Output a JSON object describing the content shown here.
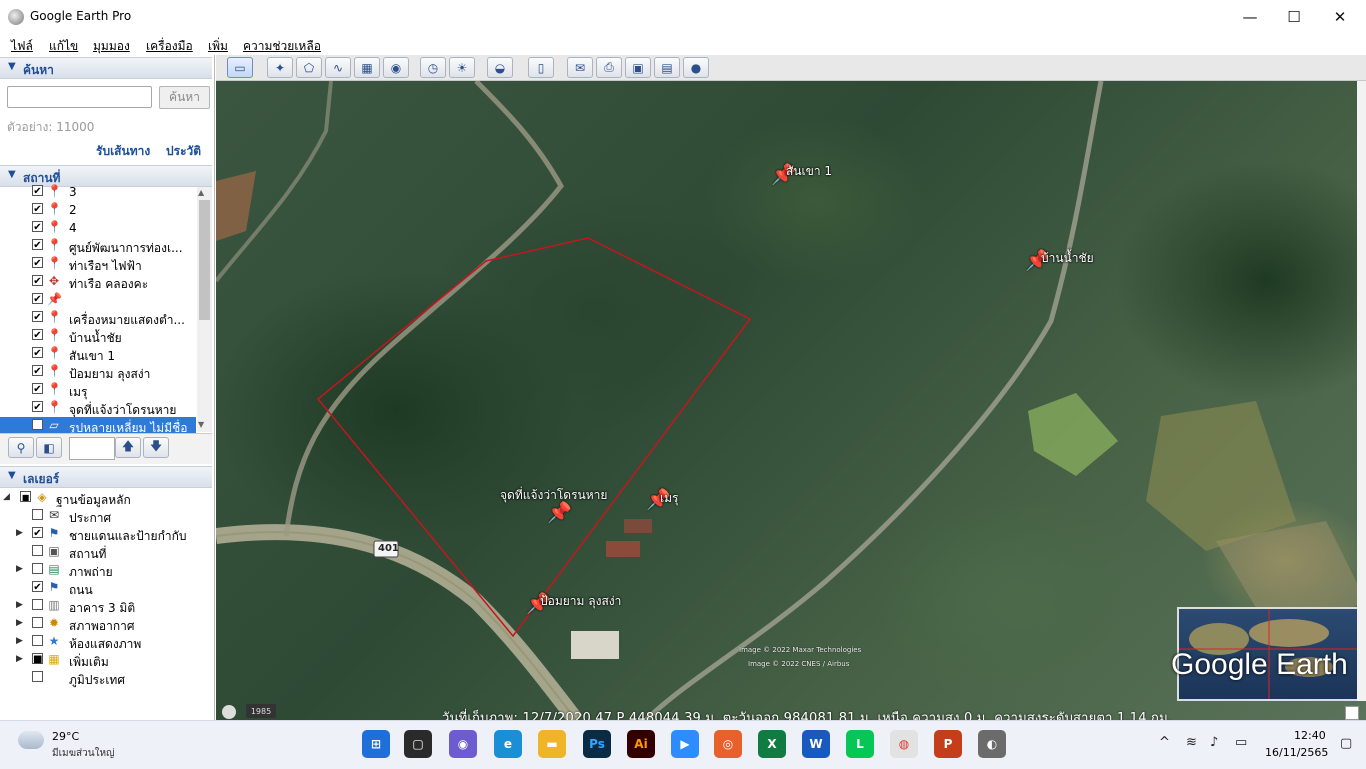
{
  "window": {
    "title": "Google Earth Pro",
    "minimize": "—",
    "maximize": "☐",
    "close": "✕"
  },
  "menu": [
    "ไฟล์",
    "แก้ไข",
    "มุมมอง",
    "เครื่องมือ",
    "เพิ่ม",
    "ความช่วยเหลือ"
  ],
  "toolbar": {
    "icons": [
      "sidebar-toggle-icon",
      "placemark-icon",
      "polygon-icon",
      "path-icon",
      "image-overlay-icon",
      "record-tour-icon",
      "historical-imagery-icon",
      "sunlight-icon",
      "planet-icon",
      "ruler-icon",
      "email-icon",
      "print-icon",
      "save-image-icon",
      "view-in-maps-icon",
      "earth-icon"
    ]
  },
  "search": {
    "header": "ค้นหา",
    "input_value": "",
    "button": "ค้นหา",
    "example": "ตัวอย่าง: 11000",
    "directions_link": "รับเส้นทาง",
    "history_link": "ประวัติ"
  },
  "places": {
    "header": "สถานที่",
    "items": [
      {
        "label": "3",
        "checked": "✔",
        "icon": "pushpin-icon"
      },
      {
        "label": "2",
        "checked": "✔",
        "icon": "pushpin-icon"
      },
      {
        "label": "4",
        "checked": "✔",
        "icon": "pushpin-icon"
      },
      {
        "label": "ศูนย์พัฒนาการท่องเ...",
        "checked": "✔",
        "icon": "pushpin-icon"
      },
      {
        "label": "ท่าเรือฯ ไฟฟ้า",
        "checked": "✔",
        "icon": "pushpin-icon"
      },
      {
        "label": "ท่าเรือ คลองคะ",
        "checked": "✔",
        "icon": "placemark-diamond-icon"
      },
      {
        "label": "",
        "checked": "✔",
        "icon": "red-pushpin-icon"
      },
      {
        "label": "เครื่องหมายแสดงตำ...",
        "checked": "✔",
        "icon": "pushpin-icon"
      },
      {
        "label": "บ้านน้ำชัย",
        "checked": "✔",
        "icon": "pushpin-icon"
      },
      {
        "label": "สันเขา 1",
        "checked": "✔",
        "icon": "pushpin-icon"
      },
      {
        "label": "ป้อมยาม ลุงสง่า",
        "checked": "✔",
        "icon": "pushpin-icon"
      },
      {
        "label": "เมรุ",
        "checked": "✔",
        "icon": "pushpin-icon"
      },
      {
        "label": "จุดที่แจ้งว่าโดรนหาย",
        "checked": "✔",
        "icon": "pushpin-icon"
      },
      {
        "label": "รูปหลายเหลี่ยม ไม่มีชื่อ",
        "checked": "✔",
        "icon": "polygon-icon",
        "selected": true
      }
    ]
  },
  "layers": {
    "header": "เลเยอร์",
    "root": "ฐานข้อมูลหลัก",
    "items": [
      {
        "label": "ประกาศ",
        "checked": "",
        "icon": "envelope-icon"
      },
      {
        "label": "ชายแดนและป้ายกำกับ",
        "checked": "✔",
        "icon": "flag-icon"
      },
      {
        "label": "สถานที่",
        "checked": "",
        "icon": "places-square-icon"
      },
      {
        "label": "ภาพถ่าย",
        "checked": "",
        "icon": "photo-icon"
      },
      {
        "label": "ถนน",
        "checked": "✔",
        "icon": "road-flag-icon"
      },
      {
        "label": "อาคาร 3 มิติ",
        "checked": "",
        "icon": "building-icon"
      },
      {
        "label": "สภาพอากาศ",
        "checked": "",
        "icon": "weather-sun-icon"
      },
      {
        "label": "ห้องแสดงภาพ",
        "checked": "",
        "icon": "gallery-star-icon"
      },
      {
        "label": "เพิ่มเติม",
        "checked": "■",
        "icon": "more-square-icon"
      },
      {
        "label": "ภูมิประเทศ",
        "checked": "",
        "icon": ""
      }
    ]
  },
  "map": {
    "placemarks": [
      "สันเขา 1",
      "บ้านน้ำชัย",
      "จุดที่แจ้งว่าโดรนหาย",
      "เมรุ",
      "ป้อมยาม ลุงสง่า"
    ],
    "road_sign": "401",
    "copyright1": "Image © 2022 Maxar Technologies",
    "copyright2": "Image © 2022 CNES / Airbus",
    "status": "วันที่เก็บภาพ: 12/7/2020    47 P 448044.39 ม. ตะวันออก 984081.81 ม. เหนือ  ความสูง      0 ม.     ความสูงระดับสายตา    1.14 กม.",
    "logo": "Google Earth",
    "year": "1985"
  },
  "taskbar": {
    "weather_temp": "29°C",
    "weather_desc": "มีเมฆส่วนใหญ่",
    "time": "12:40",
    "date": "16/11/2565",
    "apps": [
      "start-icon",
      "task-view-icon",
      "chat-icon",
      "edge-icon",
      "file-explorer-icon",
      "photoshop-icon",
      "illustrator-icon",
      "zoom-icon",
      "firefox-icon",
      "excel-icon",
      "word-icon",
      "line-icon",
      "chrome-icon",
      "powerpoint-icon",
      "google-earth-icon"
    ]
  }
}
